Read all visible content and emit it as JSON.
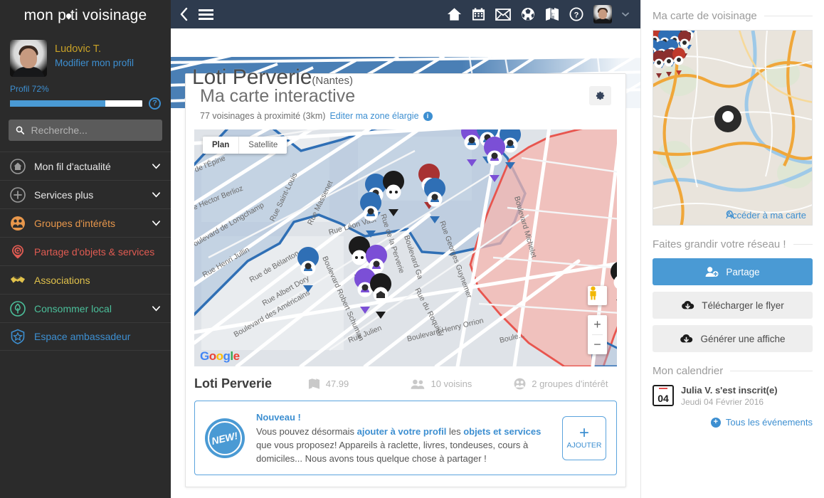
{
  "brand": {
    "part1": "mon p",
    "part2": "ti voisinage"
  },
  "profile": {
    "name": "Ludovic T.",
    "edit_link": "Modifier mon profil",
    "progress_label": "Profil 72%",
    "progress_percent": 72,
    "help_icon": "?"
  },
  "search": {
    "placeholder": "Recherche...",
    "value": "",
    "icon": "search-icon"
  },
  "sidebar": {
    "items": [
      {
        "label": "Mon fil d'actualité",
        "icon": "home-circle-icon",
        "color": "#e8e8e8",
        "icon_color": "#9a9a9a",
        "chevron": true
      },
      {
        "label": "Services plus",
        "icon": "plus-circle-icon",
        "color": "#e8e8e8",
        "icon_color": "#9a9a9a",
        "chevron": true
      },
      {
        "label": "Groupes d'intérêts",
        "icon": "people-circle-icon",
        "color": "#e8974b",
        "icon_color": "#e8974b",
        "chevron": true
      },
      {
        "label": "Partage d'objets & services",
        "icon": "at-pin-icon",
        "color": "#e05b52",
        "icon_color": "#e05b52",
        "chevron": false
      },
      {
        "label": "Associations",
        "icon": "handshake-icon",
        "color": "#e0c14b",
        "icon_color": "#e0c14b",
        "chevron": false
      },
      {
        "label": "Consommer local",
        "icon": "tree-circle-icon",
        "color": "#4bbf9a",
        "icon_color": "#4bbf9a",
        "chevron": true
      },
      {
        "label": "Espace ambassadeur",
        "icon": "star-shield-icon",
        "color": "#3d8fd1",
        "icon_color": "#3d8fd1",
        "chevron": false
      }
    ]
  },
  "topbar": {
    "back_icon": "chevron-left-icon",
    "menu_icon": "hamburger-menu-icon",
    "icons": [
      "home-icon",
      "calendar-icon",
      "envelope-icon",
      "globe-icon",
      "map-icon",
      "help-circle-icon"
    ],
    "avatar": "user-avatar",
    "caret": "chevron-down-icon"
  },
  "hero": {
    "title": "Loti Perverie",
    "subtitle": "(Nantes)"
  },
  "card": {
    "title": "Ma carte interactive",
    "subtitle": "77 voisinages à proximité (3km)",
    "edit_link": "Editer ma zone élargie",
    "info_icon": "i",
    "gear_icon": "gear-icon"
  },
  "map": {
    "types": [
      {
        "label": "Plan",
        "active": true
      },
      {
        "label": "Satellite",
        "active": false
      }
    ],
    "zoom_in": "+",
    "zoom_out": "−",
    "pegman": "street-view-pegman",
    "attribution": [
      "G",
      "o",
      "o",
      "g",
      "l",
      "e"
    ],
    "street_labels": [
      "de l'Épine",
      "e Hector Berlioz",
      "Rue Saint-Louis",
      "Rue Massenet",
      "Rue Léon Vast",
      "Boulevard de Longchamp",
      "Rue Henri Jullin",
      "Rue de Bélanton",
      "Rue Albert Dory",
      "Boulevard des Américains",
      "Boulevard Robert Schuman",
      "Rue Julien",
      "Rue de la Perverie",
      "Boulevard Gabriel Guist'hau",
      "Rue Georges Guynemer",
      "Boulevard Michelet",
      "Rue du Roquidy",
      "Boulevard Henry Orrion"
    ]
  },
  "stats": {
    "name": "Loti Perverie",
    "items": [
      {
        "icon": "map-area-icon",
        "value": "47.99"
      },
      {
        "icon": "users-icon",
        "value": "10 voisins"
      },
      {
        "icon": "group-icon",
        "value": "2 groupes d'intérêt"
      }
    ]
  },
  "notice": {
    "badge": "NEW!",
    "title": "Nouveau !",
    "text_1": "Vous pouvez désormais ",
    "bold_1": "ajouter à votre profil",
    "text_2": " les ",
    "bold_2": "objets et services",
    "text_3": " que vous proposez! Appareils à raclette, livres, tondeuses, cours à domiciles... Nous avons tous quelque chose à partager !",
    "add_plus": "+",
    "add_label": "AJOUTER"
  },
  "right": {
    "map_section_title": "Ma carte de voisinage",
    "map_link": "Accéder à ma carte",
    "map_link_icon": "search-icon",
    "network_title": "Faites grandir votre réseau !",
    "buttons": [
      {
        "label": "Partage",
        "icon": "add-user-icon",
        "style": "primary"
      },
      {
        "label": "Télécharger le flyer",
        "icon": "download-cloud-icon",
        "style": "grey"
      },
      {
        "label": "Générer une affiche",
        "icon": "download-cloud-icon",
        "style": "grey"
      }
    ],
    "calendar_title": "Mon calendrier",
    "event": {
      "day": "04",
      "title": "Julia V. s'est inscrit(e)",
      "date": "Jeudi 04 Février 2016"
    },
    "all_events": "Tous les événements",
    "all_events_icon": "plus-circle-icon"
  },
  "colors": {
    "accent_blue": "#4a9ad4",
    "link_blue": "#3d8fd1",
    "sidebar_bg": "#2b2b2b",
    "topbar_bg": "#2e3b4e",
    "zone_red": "#e8554e",
    "zone_blue": "#2f6fb5"
  }
}
